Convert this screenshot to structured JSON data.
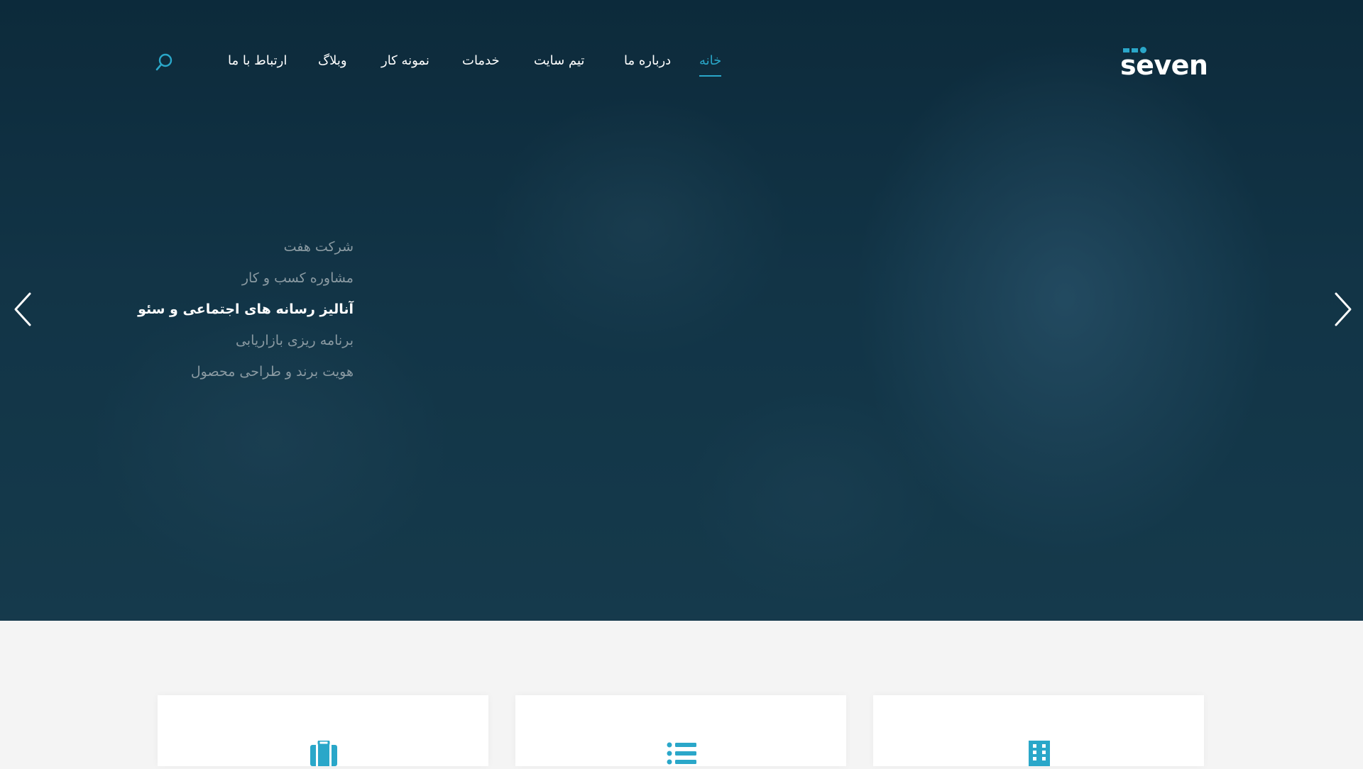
{
  "brand": {
    "logo_text": "seven",
    "accent_color": "#2aa7c9"
  },
  "nav": {
    "items": [
      {
        "label": "خانه",
        "active": true
      },
      {
        "label": "درباره ما"
      },
      {
        "label": "تیم سایت"
      },
      {
        "label": "خدمات"
      },
      {
        "label": "نمونه کار"
      },
      {
        "label": "وبلاگ"
      },
      {
        "label": "ارتباط با ما"
      }
    ],
    "search_icon": "search-icon"
  },
  "slider": {
    "items": [
      {
        "label": "شرکت هفت"
      },
      {
        "label": "مشاوره کسب و کار"
      },
      {
        "label": "آنالیز رسانه های اجتماعی و سئو",
        "active": true
      },
      {
        "label": "برنامه ریزی بازاریابی"
      },
      {
        "label": "هویت برند و طراحی محصول"
      }
    ],
    "prev_icon": "chevron-left-icon",
    "next_icon": "chevron-right-icon"
  },
  "feature_cards": [
    {
      "icon": "briefcase-icon"
    },
    {
      "icon": "list-icon"
    },
    {
      "icon": "building-icon"
    }
  ]
}
